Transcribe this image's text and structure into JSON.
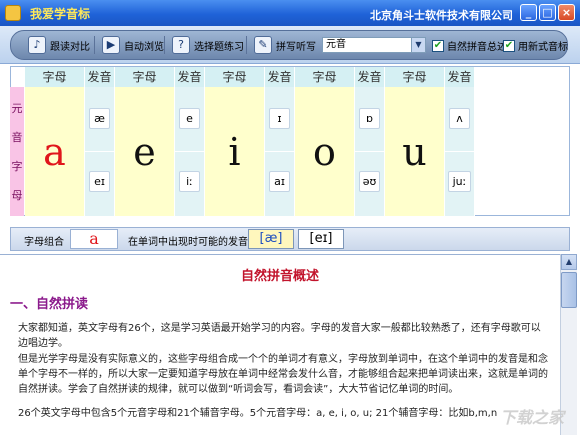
{
  "window": {
    "title": "我爱学音标",
    "company": "北京角斗士软件技术有限公司",
    "controls": {
      "minimize": "_",
      "maximize": "□",
      "close": "×"
    }
  },
  "toolbar": {
    "buttons": [
      {
        "label": "跟读对比",
        "icon": "speaker-icon",
        "glyph": "♪"
      },
      {
        "label": "自动浏览",
        "icon": "play-icon",
        "glyph": "▶"
      },
      {
        "label": "选择题练习",
        "icon": "quiz-icon",
        "glyph": "?"
      },
      {
        "label": "拼写听写",
        "icon": "pen-icon",
        "glyph": "✎"
      }
    ],
    "select": {
      "value": "元音",
      "arrow": "▼"
    },
    "checkboxes": [
      {
        "label": "自然拼音总述",
        "checked": true,
        "mark": "✔"
      },
      {
        "label": "用新式音标",
        "checked": true,
        "mark": "✔"
      }
    ]
  },
  "grid": {
    "side_label": [
      "元",
      "音",
      "字",
      "母"
    ],
    "header_letter": "字母",
    "header_sound": "发音",
    "columns": [
      {
        "letter": "a",
        "active": true,
        "sounds": [
          "æ",
          "eɪ"
        ]
      },
      {
        "letter": "e",
        "active": false,
        "sounds": [
          "e",
          "iː"
        ]
      },
      {
        "letter": "i",
        "active": false,
        "sounds": [
          "ɪ",
          "aɪ"
        ]
      },
      {
        "letter": "o",
        "active": false,
        "sounds": [
          "ɒ",
          "əʊ"
        ]
      },
      {
        "letter": "u",
        "active": false,
        "sounds": [
          "ʌ",
          "juː"
        ]
      }
    ]
  },
  "combo": {
    "label": "字母组合",
    "value": "a",
    "pron_label": "在单词中出现时可能的发音:",
    "pronunciations": [
      "[æ]",
      "[eɪ]"
    ]
  },
  "document": {
    "title": "自然拼音概述",
    "section": "一、自然拼读",
    "paragraphs": [
      "大家都知道，英文字母有26个，这是学习英语最开始学习的内容。字母的发音大家一般都比较熟悉了，还有字母歌可以边唱边学。",
      "但是光学字母是没有实际意义的，这些字母组合成一个个的单词才有意义，字母放到单词中，在这个单词中的发音是和念单个字母不一样的，所以大家一定要知道字母放在单词中经常会发什么音，才能够组合起来把单词读出来，这就是单词的自然拼读。学会了自然拼读的规律，就可以做到“听词会写，看词会读”，大大节省记忆单词的时间。",
      "26个英文字母中包含5个元音字母和21个辅音字母。5个元音字母：a, e, i, o, u; 21个辅音字母：比如b,m,n"
    ]
  },
  "scrollbar": {
    "up": "▲"
  },
  "watermark": "下载之家"
}
